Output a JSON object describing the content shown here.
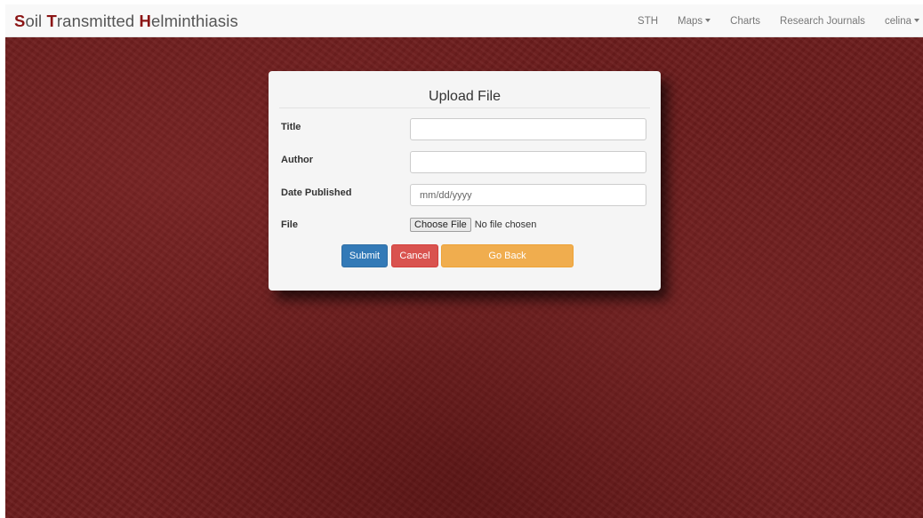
{
  "navbar": {
    "brand": [
      {
        "cap": "S",
        "rest": "oil "
      },
      {
        "cap": "T",
        "rest": "ransmitted "
      },
      {
        "cap": "H",
        "rest": "elminthiasis"
      }
    ],
    "links": [
      {
        "label": "STH",
        "dropdown": false
      },
      {
        "label": "Maps",
        "dropdown": true
      },
      {
        "label": "Charts",
        "dropdown": false
      },
      {
        "label": "Research Journals",
        "dropdown": false
      },
      {
        "label": "celina",
        "dropdown": true
      }
    ]
  },
  "modal": {
    "title": "Upload File",
    "fields": {
      "title_label": "Title",
      "title_value": "",
      "author_label": "Author",
      "author_value": "",
      "date_label": "Date Published",
      "date_placeholder": "mm/dd/yyyy",
      "file_label": "File",
      "file_button": "Choose File",
      "file_status": "No file chosen"
    },
    "buttons": {
      "submit": "Submit",
      "cancel": "Cancel",
      "back": "Go Back"
    }
  },
  "colors": {
    "brand_accent": "#8b1515",
    "background": "#6b1c1c",
    "submit": "#337ab7",
    "cancel": "#d9534f",
    "back": "#f0ad4e"
  }
}
